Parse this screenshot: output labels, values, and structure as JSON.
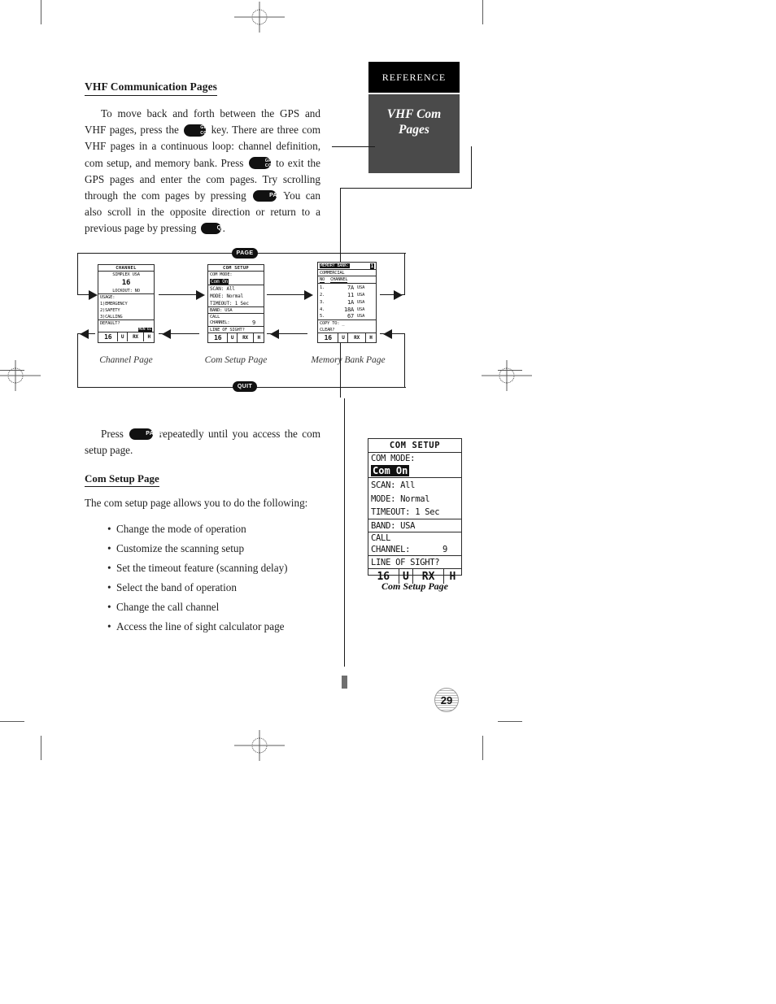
{
  "sidebar": {
    "section_tab": "REFERENCE",
    "title_line1": "VHF Com",
    "title_line2": "Pages"
  },
  "body": {
    "heading": "VHF Communication Pages",
    "para1_a": "To move back and forth between the GPS and VHF pages, press the",
    "para1_b": "key. There are three com VHF pages in a continuous loop: channel definition, com setup, and memory bank. Press",
    "para1_c": "to exit the GPS pages and enter the com pages. Try scrolling through the com pages by pressing",
    "para1_d": "You can also scroll in the opposite direction or return to a previous page by pressing",
    "para1_e": ".",
    "para2_a": "Press",
    "para2_b": "repeatedly until you access the com setup page.",
    "subheading": "Com Setup Page",
    "intro": "The com setup page allows you to do the following:",
    "bullets": [
      "Change the mode of operation",
      "Customize the scanning setup",
      "Set the timeout feature (scanning delay)",
      "Select the band of operation",
      "Change the call channel",
      "Access the line of sight calculator page"
    ]
  },
  "keys": {
    "gps": "GPS",
    "com": "COM",
    "page": "PAGE",
    "quit": "QUIT"
  },
  "figure": {
    "top_key": "PAGE",
    "bottom_key": "QUIT",
    "captions": {
      "channel": "Channel Page",
      "com_setup": "Com Setup Page",
      "memory_bank": "Memory Bank Page"
    }
  },
  "channel_screen": {
    "title": "CHANNEL",
    "simplex": "SIMPLEX USA",
    "number": "16",
    "lockout": "LOCKOUT: NO",
    "usage_label": "USAGE:",
    "usage": [
      "1)EMERGENCY",
      "2)SAFETY",
      "3)CALLING"
    ],
    "default": "DEFAULT?",
    "mon_tag": "MON 61",
    "status": {
      "ch": "16",
      "u": "U",
      "rx": "RX",
      "h": "H"
    }
  },
  "com_setup_screen": {
    "title": "COM SETUP",
    "com_mode_label": "COM MODE:",
    "com_mode_value": "Com On",
    "scan": "SCAN: All",
    "mode": "MODE: Normal",
    "timeout": "TIMEOUT:  1 Sec",
    "band": "BAND:   USA",
    "call_label": "CALL",
    "channel_label": "CHANNEL:",
    "channel_value": "9",
    "line_of_sight": "LINE OF SIGHT?",
    "status": {
      "ch": "16",
      "u": "U",
      "rx": "RX",
      "h": "H"
    }
  },
  "memory_bank_screen": {
    "title": "MEMORY BANK:",
    "bank_number": "1",
    "subtitle": "COMMERCIAL",
    "col_no": "NO",
    "col_channel": "CHANNEL",
    "rows": [
      {
        "no": "1.",
        "channel": "7A",
        "band": "USA"
      },
      {
        "no": "2.",
        "channel": "11",
        "band": "USA"
      },
      {
        "no": "3.",
        "channel": "1A",
        "band": "USA"
      },
      {
        "no": "4.",
        "channel": "18A",
        "band": "USA"
      },
      {
        "no": "5.",
        "channel": "67",
        "band": "USA"
      }
    ],
    "copy_to": "COPY TO:  _",
    "clear": "CLEAR?",
    "status": {
      "ch": "16",
      "u": "U",
      "rx": "RX",
      "h": "H"
    }
  },
  "caption_main": "Com Setup Page",
  "page_number": "29",
  "colors": {
    "tab_black": "#000000",
    "tab_gray": "#4a4a4a",
    "ink": "#1a1a1a"
  }
}
